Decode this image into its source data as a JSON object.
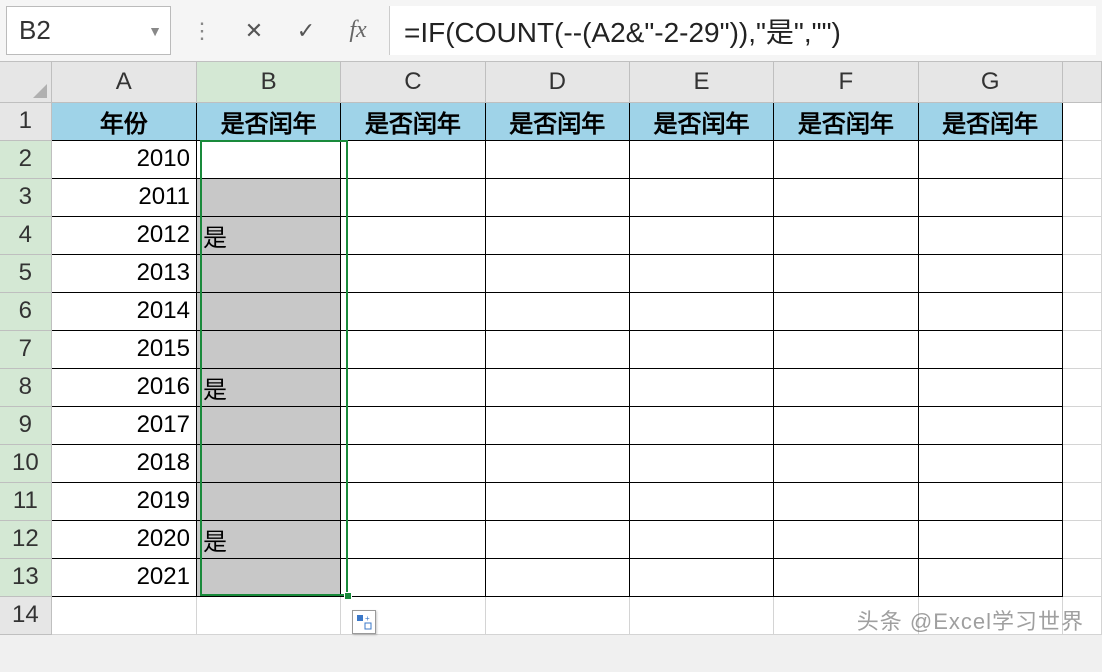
{
  "name_box": {
    "value": "B2"
  },
  "formula_bar": {
    "formula": "=IF(COUNT(--(A2&\"-2-29\")),\"是\",\"\")",
    "fx_label": "fx"
  },
  "columns": [
    "A",
    "B",
    "C",
    "D",
    "E",
    "F",
    "G"
  ],
  "selected_col": "B",
  "rows": [
    1,
    2,
    3,
    4,
    5,
    6,
    7,
    8,
    9,
    10,
    11,
    12,
    13,
    14
  ],
  "header_row": {
    "A": "年份",
    "B": "是否闰年",
    "C": "是否闰年",
    "D": "是否闰年",
    "E": "是否闰年",
    "F": "是否闰年",
    "G": "是否闰年"
  },
  "data_rows": [
    {
      "year": "2010",
      "leap": ""
    },
    {
      "year": "2011",
      "leap": ""
    },
    {
      "year": "2012",
      "leap": "是"
    },
    {
      "year": "2013",
      "leap": ""
    },
    {
      "year": "2014",
      "leap": ""
    },
    {
      "year": "2015",
      "leap": ""
    },
    {
      "year": "2016",
      "leap": "是"
    },
    {
      "year": "2017",
      "leap": ""
    },
    {
      "year": "2018",
      "leap": ""
    },
    {
      "year": "2019",
      "leap": ""
    },
    {
      "year": "2020",
      "leap": "是"
    },
    {
      "year": "2021",
      "leap": ""
    }
  ],
  "selection": {
    "start": "B2",
    "end": "B13",
    "active": "B2"
  },
  "watermark": "头条 @Excel学习世界"
}
